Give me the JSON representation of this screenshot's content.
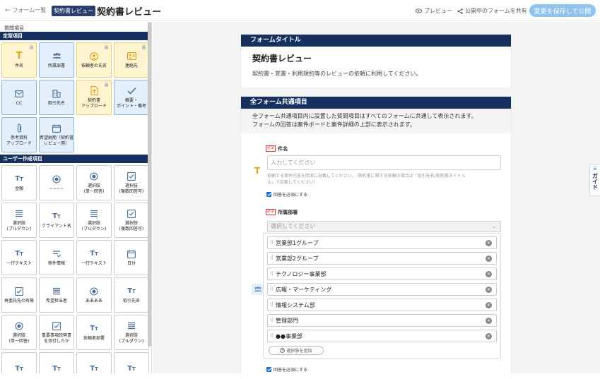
{
  "header": {
    "back_label": "フォーム一覧",
    "badge": "契約書レビュー",
    "title": "契約書レビュー",
    "preview_label": "プレビュー",
    "share_label": "公開中のフォームを共有",
    "save_label": "変更を保存して公開"
  },
  "sidebar": {
    "heading": "質問項目",
    "section_fixed": "定型項目",
    "fixed_items": [
      {
        "label": "件名",
        "icon": "text-t-icon",
        "style": "yellow",
        "locked": true
      },
      {
        "label": "所属部署",
        "icon": "group-icon",
        "style": "blue",
        "locked": false
      },
      {
        "label": "依頼者の氏名",
        "icon": "person-icon",
        "style": "yellow",
        "locked": true
      },
      {
        "label": "連絡先",
        "icon": "contact-card-icon",
        "style": "yellow",
        "locked": true
      },
      {
        "label": "CC",
        "icon": "mail-icon",
        "style": "blue",
        "locked": false
      },
      {
        "label": "取引先名",
        "icon": "building-icon",
        "style": "blue",
        "locked": false
      },
      {
        "label": "契約書\nアップロード",
        "icon": "file-upload-icon",
        "style": "yellow",
        "locked": true
      },
      {
        "label": "概要・\nポイント・備考",
        "icon": "check-icon",
        "style": "blue",
        "locked": false
      },
      {
        "label": "参考資料\nアップロード",
        "icon": "paperclip-icon",
        "style": "blue",
        "locked": false
      },
      {
        "label": "希望納期（契約書\nレビュー用）",
        "icon": "calendar-icon",
        "style": "blue",
        "locked": false
      }
    ],
    "section_user": "ユーザー作成項目",
    "user_items": [
      {
        "label": "金額",
        "icon": "text-tt-icon"
      },
      {
        "label": "~~~~",
        "icon": "radio-icon"
      },
      {
        "label": "選択肢\n(単一回答)",
        "icon": "radio-icon"
      },
      {
        "label": "選択肢\n(複数回答可)",
        "icon": "checkbox-icon"
      },
      {
        "label": "選択肢\n(プルダウン)",
        "icon": "list-icon"
      },
      {
        "label": "クライアント名",
        "icon": "text-tt-icon"
      },
      {
        "label": "選択肢\n(プルダウン)",
        "icon": "list-icon"
      },
      {
        "label": "選択肢\n(複数回答可)",
        "icon": "checkbox-icon"
      },
      {
        "label": "一行テキスト",
        "icon": "text-tt-icon"
      },
      {
        "label": "物件情報",
        "icon": "lines-icon"
      },
      {
        "label": "一行テキスト",
        "icon": "text-tt-icon"
      },
      {
        "label": "日付",
        "icon": "calendar-icon"
      },
      {
        "label": "再委託先の有無",
        "icon": "checkbox-icon"
      },
      {
        "label": "希望担当者",
        "icon": "list-icon"
      },
      {
        "label": "ああああ",
        "icon": "radio-icon"
      },
      {
        "label": "取引先名",
        "icon": "text-tt-icon"
      },
      {
        "label": "選択肢\n(単一回答)",
        "icon": "radio-icon"
      },
      {
        "label": "重要事項説明書\nを添付したか",
        "icon": "checkbox-icon"
      },
      {
        "label": "依頼者部署",
        "icon": "text-tt-icon"
      },
      {
        "label": "選択肢\n(プルダウン)",
        "icon": "list-icon"
      },
      {
        "label": "",
        "icon": "text-tt-icon"
      },
      {
        "label": "",
        "icon": "text-tt-icon"
      },
      {
        "label": "",
        "icon": "text-tt-icon"
      },
      {
        "label": "",
        "icon": "text-tt-icon"
      }
    ]
  },
  "form": {
    "title_header": "フォームタイトル",
    "title": "契約書レビュー",
    "description": "契約書・覚書・利用規約等のレビューの依頼に利用してください。",
    "common_header": "全フォーム共通項目",
    "common_info_1": "全フォーム共通項目内に設置した質問項目はすべてのフォームに共通して表示されます。",
    "common_info_2": "フォームの回答は案件ボードと案件詳細の上部に表示されます。",
    "required_badge": "必須",
    "field1": {
      "label": "件名",
      "placeholder": "入力してください",
      "help_1": "依頼する案件内容を簡潔に記載してください。（契約書に関する依頼の場合は「取引先名/契約書タイトル",
      "help_2": "ル」で記載してください）",
      "required_label": "回答を必須にする"
    },
    "field2": {
      "label": "所属部署",
      "select_placeholder": "選択してください",
      "options": [
        "営業部1グループ",
        "営業部2グループ",
        "テクノロジー事業部",
        "広報・マーケティング",
        "情報システム部",
        "管理部門",
        "●●事業部"
      ],
      "add_label": "選択肢を追加",
      "required_label": "回答を必須にする"
    }
  },
  "guide_label": "ガイド",
  "colors": {
    "navy": "#16305f",
    "save": "#8fc3ee",
    "accent": "#1b6fd0"
  }
}
